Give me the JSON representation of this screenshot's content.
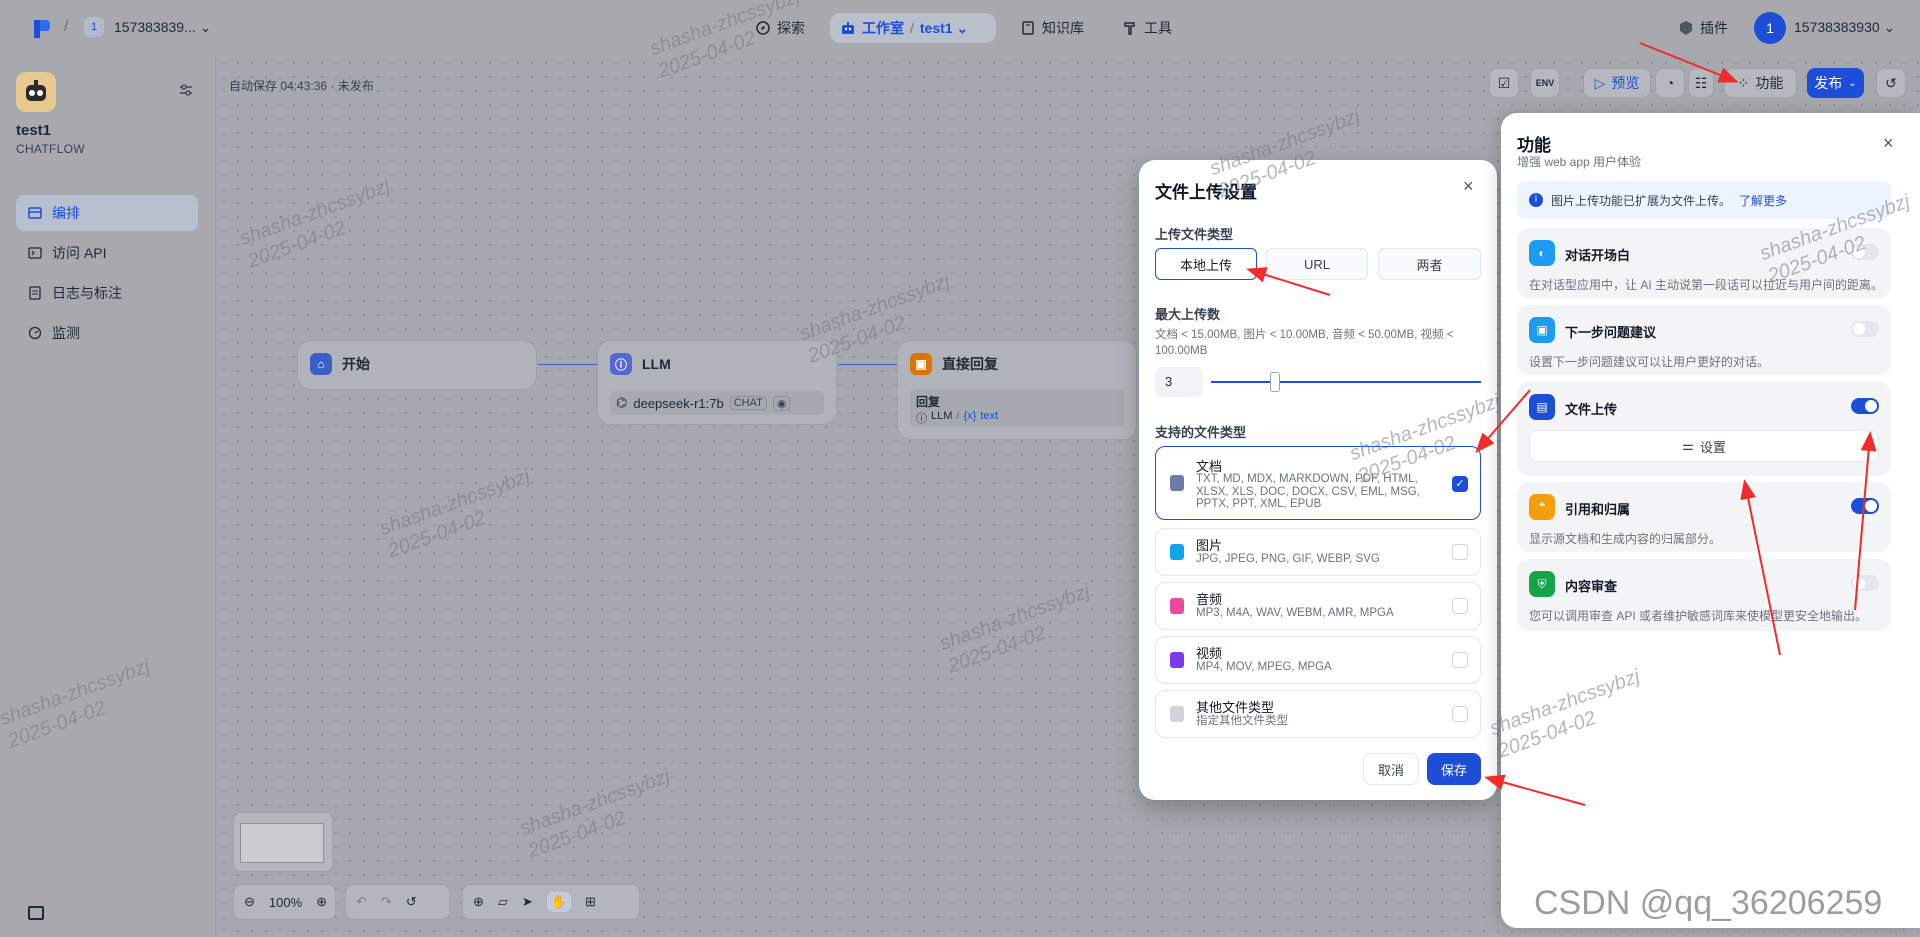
{
  "header": {
    "workspace_badge": "1",
    "workspace_name": "157383839... ⌄",
    "nav": [
      {
        "label": "探索"
      },
      {
        "label": "工作室"
      },
      {
        "label": "test1 ⌄"
      },
      {
        "label": "知识库"
      },
      {
        "label": "工具"
      }
    ],
    "plugin_label": "插件",
    "avatar": "1",
    "user_id": "15738383930 ⌄"
  },
  "sidebar": {
    "app_name": "test1",
    "app_type": "CHATFLOW",
    "items": [
      {
        "label": "编排",
        "icon": "layout-icon"
      },
      {
        "label": "访问 API",
        "icon": "terminal-icon"
      },
      {
        "label": "日志与标注",
        "icon": "log-icon"
      },
      {
        "label": "监测",
        "icon": "monitor-icon"
      }
    ]
  },
  "canvas": {
    "autosave": "自动保存 04:43:36 · 未发布",
    "nodes": {
      "start": "开始",
      "llm": "LLM",
      "llm_model": "deepseek-r1:7b",
      "llm_mode": "CHAT",
      "answer": "直接回复",
      "answer_label": "回复",
      "answer_var_src": "LLM",
      "answer_var": "text"
    },
    "zoom": "100%"
  },
  "toolbar": {
    "preview": "预览",
    "features": "功能",
    "publish": "发布"
  },
  "modal": {
    "title": "文件上传设置",
    "upload_type_label": "上传文件类型",
    "upload_types": [
      "本地上传",
      "URL",
      "两者"
    ],
    "selected_upload_type": "本地上传",
    "max_upload_label": "最大上传数",
    "limits_hint": "文档 < 15.00MB, 图片 < 10.00MB, 音频 < 50.00MB, 视频 < 100.00MB",
    "max_upload_value": "3",
    "max_upload_fraction": 0.2,
    "supported_label": "支持的文件类型",
    "file_types": [
      {
        "name": "文档",
        "ext": "TXT, MD, MDX, MARKDOWN, PDF, HTML, XLSX, XLS, DOC, DOCX, CSV, EML, MSG, PPTX, PPT, XML, EPUB",
        "checked": true,
        "color": "#6b7ca7"
      },
      {
        "name": "图片",
        "ext": "JPG, JPEG, PNG, GIF, WEBP, SVG",
        "checked": false,
        "color": "#0ea5e9"
      },
      {
        "name": "音频",
        "ext": "MP3, M4A, WAV, WEBM, AMR, MPGA",
        "checked": false,
        "color": "#ec4899"
      },
      {
        "name": "视频",
        "ext": "MP4, MOV, MPEG, MPGA",
        "checked": false,
        "color": "#7c3aed"
      },
      {
        "name": "其他文件类型",
        "ext": "指定其他文件类型",
        "checked": false,
        "color": "#d1d5db"
      }
    ],
    "cancel": "取消",
    "save": "保存"
  },
  "panel": {
    "title": "功能",
    "subtitle": "增强 web app 用户体验",
    "info": "图片上传功能已扩展为文件上传。",
    "info_link": "了解更多",
    "features": [
      {
        "name": "对话开场白",
        "desc": "在对话型应用中，让 AI 主动说第一段话可以拉近与用户间的距离。",
        "enabled": false,
        "color": "#1d9bf0"
      },
      {
        "name": "下一步问题建议",
        "desc": "设置下一步问题建议可以让用户更好的对话。",
        "enabled": false,
        "color": "#1d9bf0"
      },
      {
        "name": "文件上传",
        "setting": "设置",
        "enabled": true,
        "color": "#1d4ed8"
      },
      {
        "name": "引用和归属",
        "desc": "显示源文档和生成内容的归属部分。",
        "enabled": true,
        "color": "#f59e0b"
      },
      {
        "name": "内容审查",
        "desc": "您可以调用审查 API 或者维护敏感词库来使模型更安全地输出。",
        "enabled": false,
        "color": "#16a34a"
      }
    ]
  },
  "watermark": {
    "text": "shasha-zhcssybzj",
    "date": "2025-04-02",
    "csdn": "CSDN @qq_36206259"
  },
  "colors": {
    "accent": "#1d4ed8",
    "annotation_arrow": "#ef2b2b"
  }
}
